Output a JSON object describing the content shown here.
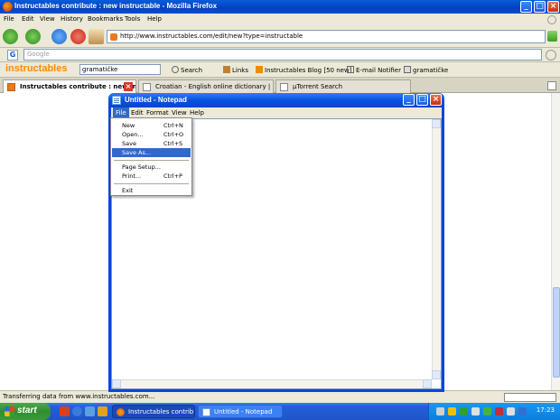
{
  "firefox": {
    "title": "Instructables contribute : new instructable - Mozilla Firefox",
    "menu": [
      "File",
      "Edit",
      "View",
      "History",
      "Bookmarks",
      "Tools",
      "Help"
    ],
    "url": "http://www.instructables.com/edit/new?type=instructable",
    "google_placeholder": "Google",
    "google_logo": "G",
    "status": "Transferring data from www.instructables.com..."
  },
  "instructables_bar": {
    "brand": "instructables",
    "search_value": "gramatičke",
    "search_label": "Search",
    "links_label": "Links",
    "blog_label": "Instructables Blog [50 new]",
    "notifier_label": "E-mail Notifier",
    "last_label": "gramatičke"
  },
  "tabs": [
    {
      "label": "Instructables contribute : new in..."
    },
    {
      "label": "Croatian - English online dictionary | H..."
    },
    {
      "label": "µTorrent Search"
    }
  ],
  "notepad": {
    "title": "Untitled - Notepad",
    "menu": [
      "File",
      "Edit",
      "Format",
      "View",
      "Help"
    ],
    "file_menu": [
      {
        "label": "New",
        "shortcut": "Ctrl+N"
      },
      {
        "label": "Open...",
        "shortcut": "Ctrl+O"
      },
      {
        "label": "Save",
        "shortcut": "Ctrl+S"
      },
      {
        "label": "Save As...",
        "shortcut": ""
      },
      {
        "label": "Page Setup...",
        "shortcut": ""
      },
      {
        "label": "Print...",
        "shortcut": "Ctrl+P"
      },
      {
        "label": "Exit",
        "shortcut": ""
      }
    ],
    "highlighted_item": "Save As..."
  },
  "taskbar": {
    "start_label": "start",
    "tasks": [
      {
        "label": "Instructables contrib..."
      },
      {
        "label": "Untitled - Notepad"
      }
    ],
    "clock": "17:23"
  }
}
